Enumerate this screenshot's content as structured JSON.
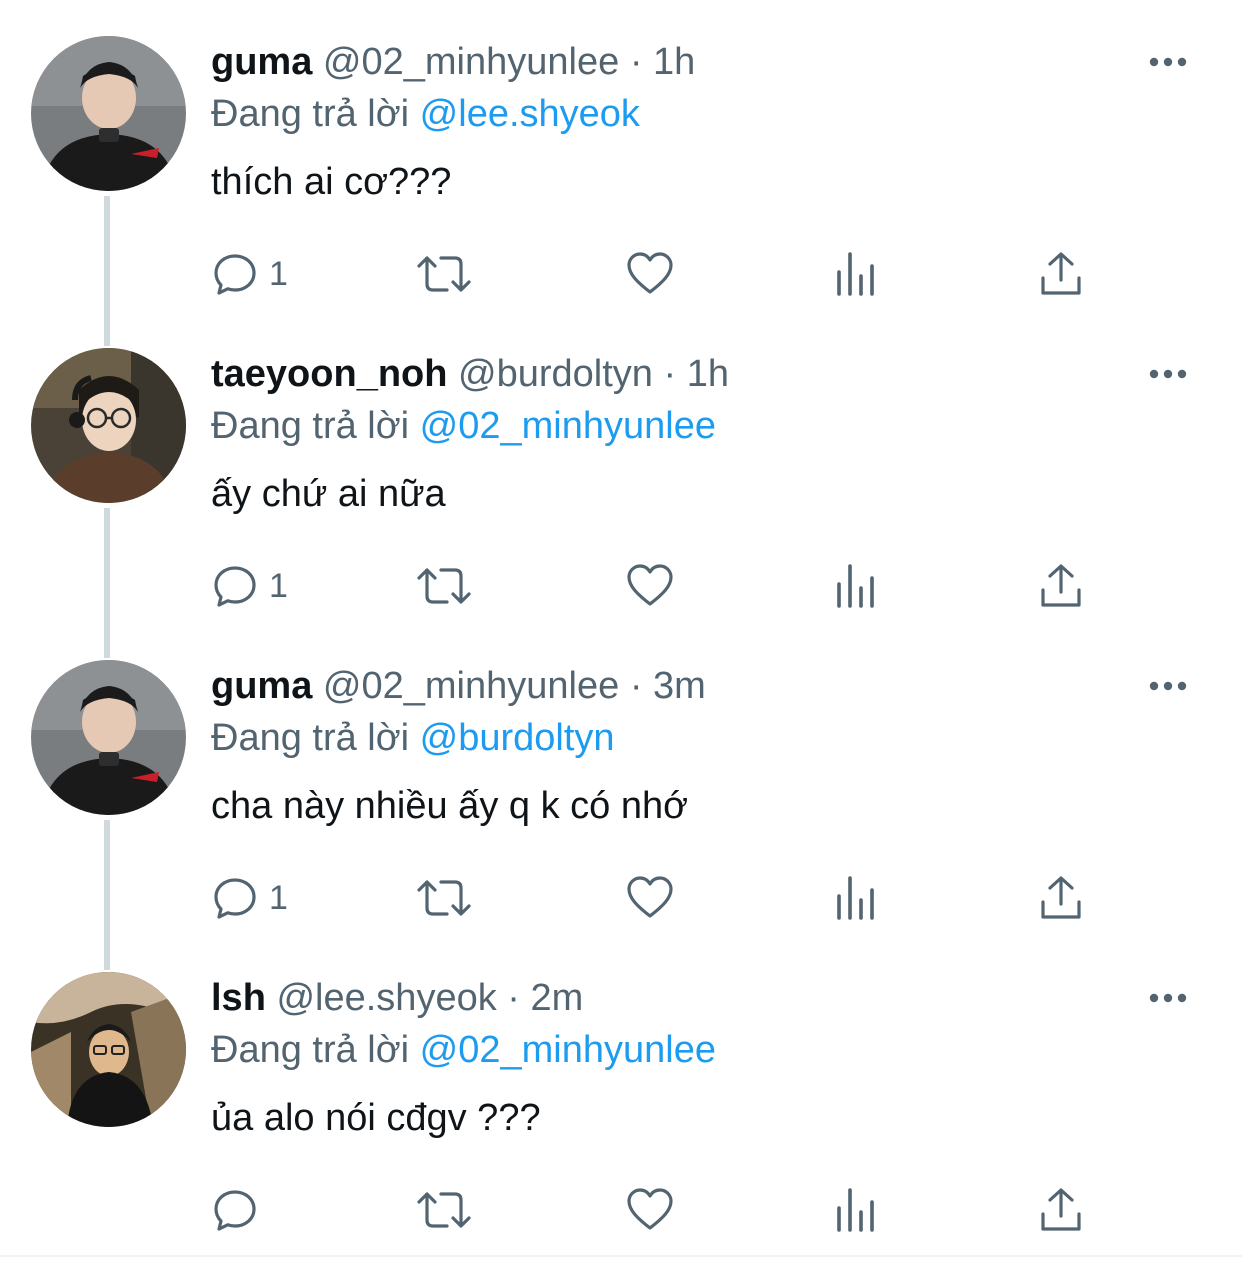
{
  "colors": {
    "text_primary": "#0f1419",
    "text_secondary": "#536471",
    "mention": "#1d9bf0",
    "thread_line": "#cfd9de"
  },
  "reply_prefix": "Đang trả lời",
  "tweets": [
    {
      "name": "guma",
      "handle": "@02_minhyunlee",
      "dot": "·",
      "time": "1h",
      "reply_to": "@lee.shyeok",
      "text": "thích ai cơ???",
      "reply_count": "1",
      "avatar_icon": "user-avatar"
    },
    {
      "name": "taeyoon_noh",
      "handle": "@burdoltyn",
      "dot": "·",
      "time": "1h",
      "reply_to": "@02_minhyunlee",
      "text": "ấy chứ ai nữa",
      "reply_count": "1",
      "avatar_icon": "user-avatar"
    },
    {
      "name": "guma",
      "handle": "@02_minhyunlee",
      "dot": "·",
      "time": "3m",
      "reply_to": "@burdoltyn",
      "text": "cha này nhiều ấy q k có nhớ",
      "reply_count": "1",
      "avatar_icon": "user-avatar"
    },
    {
      "name": "lsh",
      "handle": "@lee.shyeok",
      "dot": "·",
      "time": "2m",
      "reply_to": "@02_minhyunlee",
      "text": "ủa alo nói cđgv ???",
      "reply_count": "",
      "avatar_icon": "user-avatar"
    }
  ],
  "action_icons": [
    "reply-icon",
    "retweet-icon",
    "like-icon",
    "views-icon",
    "share-icon"
  ]
}
